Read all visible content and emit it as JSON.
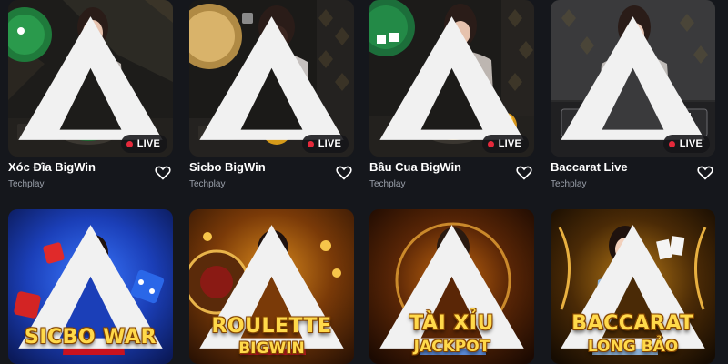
{
  "games": [
    {
      "title": "Xóc Đĩa BigWin",
      "provider": "Techplay",
      "badge": "LIVE"
    },
    {
      "title": "Sicbo BigWin",
      "provider": "Techplay",
      "badge": "LIVE"
    },
    {
      "title": "Bầu Cua BigWin",
      "provider": "Techplay",
      "badge": "LIVE"
    },
    {
      "title": "Baccarat Live",
      "provider": "Techplay",
      "badge": "LIVE"
    }
  ],
  "banners": [
    {
      "line1": "SICBO WAR",
      "line2": ""
    },
    {
      "line1": "ROULETTE",
      "line2": "BIGWIN"
    },
    {
      "line1": "TÀI XỈU",
      "line2": "JACKPOT"
    },
    {
      "line1": "BACCARAT",
      "line2": "LONG BẢO"
    }
  ],
  "icons": {
    "favorite": "heart-outline-icon",
    "provider_mark": "triangle-logo-icon",
    "live": "red-dot-icon"
  },
  "colors": {
    "background": "#15171c",
    "live_dot": "#e5293b",
    "banner_gold": "#ffd94a",
    "provider_text": "#9aa0aa"
  }
}
